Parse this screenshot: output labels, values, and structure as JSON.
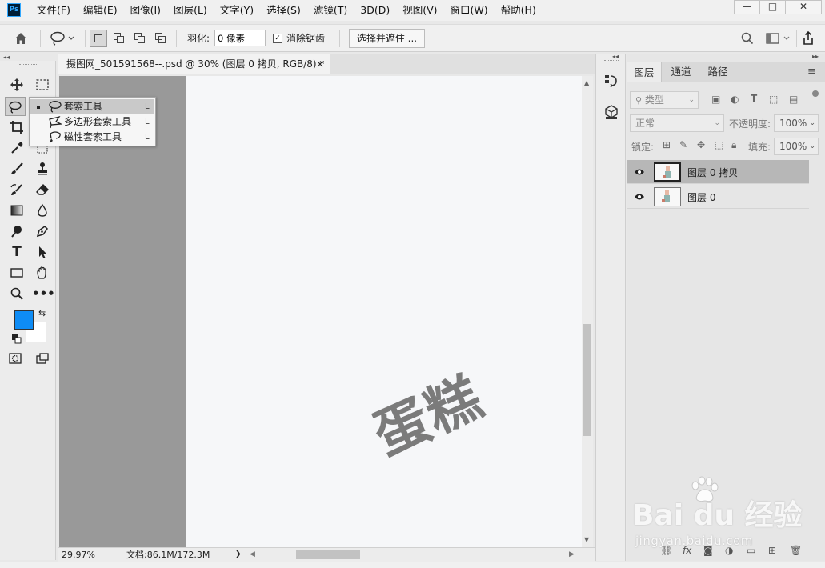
{
  "app": {
    "logo": "Ps"
  },
  "menu": [
    "文件(F)",
    "编辑(E)",
    "图像(I)",
    "图层(L)",
    "文字(Y)",
    "选择(S)",
    "滤镜(T)",
    "3D(D)",
    "视图(V)",
    "窗口(W)",
    "帮助(H)"
  ],
  "window_controls": {
    "minimize": "—",
    "maximize": "□",
    "close": "✕"
  },
  "options": {
    "feather_label": "羽化:",
    "feather_value": "0 像素",
    "antialias_label": "消除锯齿",
    "antialias_checked": true,
    "select_mask_label": "选择并遮住 ..."
  },
  "document": {
    "tab_title": "摄图网_501591568--.psd @ 30% (图层 0 拷贝, RGB/8) *",
    "close": "×",
    "canvas_text": "蛋糕",
    "zoom": "29.97%",
    "doc_size": "文档:86.1M/172.3M",
    "status_arrow": "❯"
  },
  "flyout": [
    {
      "label": "套索工具",
      "key": "L",
      "active": true
    },
    {
      "label": "多边形套索工具",
      "key": "L",
      "active": false
    },
    {
      "label": "磁性套索工具",
      "key": "L",
      "active": false
    }
  ],
  "colors": {
    "foreground": "#0e8cf5",
    "background": "#ffffff"
  },
  "layers_panel": {
    "tabs": [
      "图层",
      "通道",
      "路径"
    ],
    "active_tab": "图层",
    "filter_placeholder": "类型",
    "blend_mode": "正常",
    "opacity_label": "不透明度:",
    "opacity_value": "100%",
    "lock_label": "锁定:",
    "fill_label": "填充:",
    "fill_value": "100%",
    "layers": [
      {
        "name": "图层 0 拷贝",
        "selected": true
      },
      {
        "name": "图层 0",
        "selected": false
      }
    ]
  },
  "watermark": {
    "logo": "Bai du 经验",
    "url": "jingyan.baidu.com"
  }
}
